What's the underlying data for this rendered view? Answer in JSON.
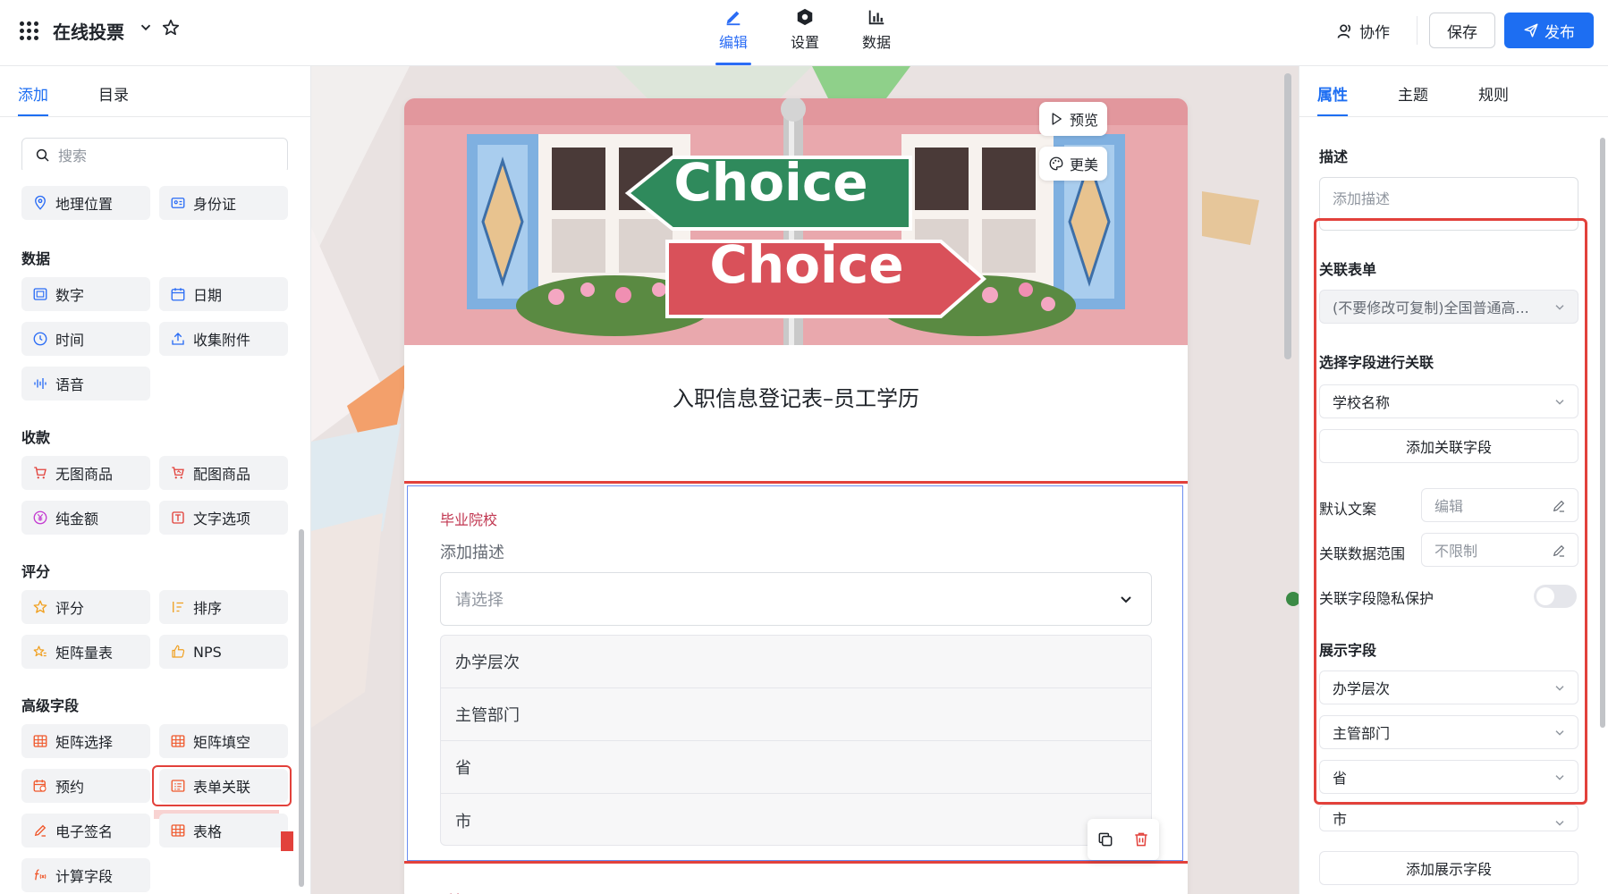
{
  "header": {
    "app_title": "在线投票",
    "modes": [
      {
        "label": "编辑",
        "icon": "pen-icon",
        "active": true
      },
      {
        "label": "设置",
        "icon": "hexagon-gear-icon",
        "active": false
      },
      {
        "label": "数据",
        "icon": "bar-chart-icon",
        "active": false
      }
    ],
    "collab_label": "协作",
    "save_label": "保存",
    "publish_label": "发布"
  },
  "left": {
    "tabs": [
      "添加",
      "目录"
    ],
    "search_placeholder": "搜索",
    "partial_items": [
      "地理位置",
      "身份证"
    ],
    "sections": {
      "data": {
        "title": "数据",
        "items": [
          "数字",
          "日期",
          "时间",
          "收集附件",
          "语音"
        ]
      },
      "payment": {
        "title": "收款",
        "items": [
          "无图商品",
          "配图商品",
          "纯金额",
          "文字选项"
        ]
      },
      "rating": {
        "title": "评分",
        "items": [
          "评分",
          "排序",
          "矩阵量表",
          "NPS"
        ]
      },
      "advanced": {
        "title": "高级字段",
        "items": [
          "矩阵选择",
          "矩阵填空",
          "预约",
          "表单关联",
          "电子签名",
          "表格",
          "计算字段"
        ]
      }
    }
  },
  "canvas": {
    "preview_label": "预览",
    "beautify_label": "更美",
    "banner_text_top": "Choice",
    "banner_text_bottom": "Choice",
    "form_title": "入职信息登记表–员工学历",
    "field": {
      "label": "毕业院校",
      "description": "添加描述",
      "placeholder": "请选择",
      "display_fields": [
        "办学层次",
        "主管部门",
        "省",
        "市"
      ]
    },
    "next_field_label": "手机"
  },
  "right": {
    "tabs": [
      "属性",
      "主题",
      "规则"
    ],
    "description_label": "描述",
    "description_placeholder": "添加描述",
    "linked_form_label": "关联表单",
    "linked_form_value": "(不要修改可复制)全国普通高...",
    "select_field_label": "选择字段进行关联",
    "select_field_value": "学校名称",
    "add_link_field": "添加关联字段",
    "default_text_label": "默认文案",
    "default_text_value": "编辑",
    "range_label": "关联数据范围",
    "range_value": "不限制",
    "privacy_label": "关联字段隐私保护",
    "privacy_on": false,
    "display_fields_label": "展示字段",
    "display_fields": [
      "办学层次",
      "主管部门",
      "省",
      "市"
    ],
    "add_display_field": "添加展示字段"
  },
  "colors": {
    "accent": "#1d6ef2",
    "highlight": "#e2413b",
    "field_label": "#c0354f"
  }
}
